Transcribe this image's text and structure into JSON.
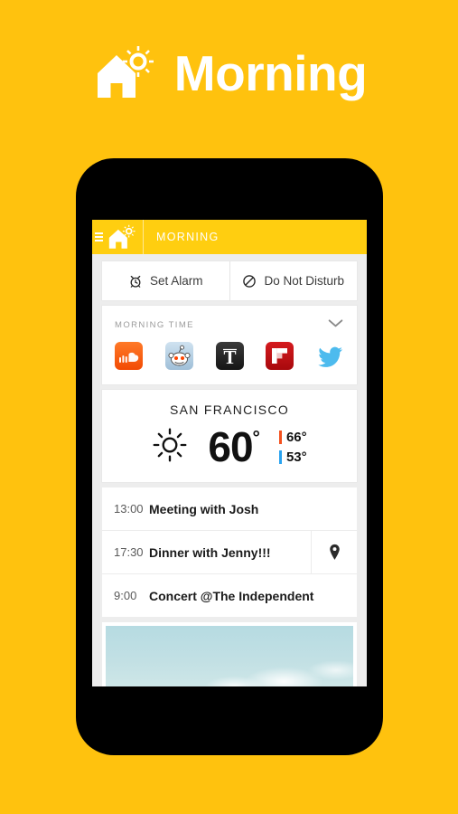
{
  "hero": {
    "title": "Morning",
    "logo_icon": "house-sun-icon",
    "background_color": "#FFC20E",
    "text_color": "#FFFFFF"
  },
  "phone": {
    "frame_color": "#000000",
    "screen_background": "#EDEDED"
  },
  "appbar": {
    "menu_icon": "hamburger-menu-icon",
    "logo_icon": "house-sun-icon",
    "title": "MORNING",
    "background_color": "#FFCE10"
  },
  "quick_actions": [
    {
      "label": "Set Alarm",
      "icon": "alarm-clock-icon"
    },
    {
      "label": "Do Not Disturb",
      "icon": "do-not-disturb-icon"
    }
  ],
  "morning_time": {
    "label": "MORNING TIME",
    "collapse_icon": "chevron-down-icon",
    "apps": [
      {
        "name": "SoundCloud",
        "icon": "soundcloud-icon",
        "color": "#F5500F"
      },
      {
        "name": "Reddit",
        "icon": "reddit-icon",
        "color": "#A9C6DE"
      },
      {
        "name": "New York Times",
        "icon": "nytimes-icon",
        "color": "#2B2B2B"
      },
      {
        "name": "Flipboard",
        "icon": "flipboard-icon",
        "color": "#BE1014"
      },
      {
        "name": "Twitter",
        "icon": "twitter-icon",
        "color": "#4DBBEE"
      }
    ]
  },
  "weather": {
    "city": "SAN FRANCISCO",
    "condition_icon": "sun-icon",
    "temperature": "60",
    "degree_symbol": "°",
    "high": "66°",
    "low": "53°",
    "high_color": "#F4511E",
    "low_color": "#29A3F0"
  },
  "events": [
    {
      "time": "13:00",
      "title": "Meeting with Josh",
      "has_location": false
    },
    {
      "time": "17:30",
      "title": "Dinner with Jenny!!!",
      "has_location": true,
      "location_icon": "map-pin-icon"
    },
    {
      "time": "9:00",
      "title": "Concert @The Independent",
      "has_location": false
    }
  ],
  "photo_card": {
    "image_alt": "sky-with-clouds-photo"
  }
}
